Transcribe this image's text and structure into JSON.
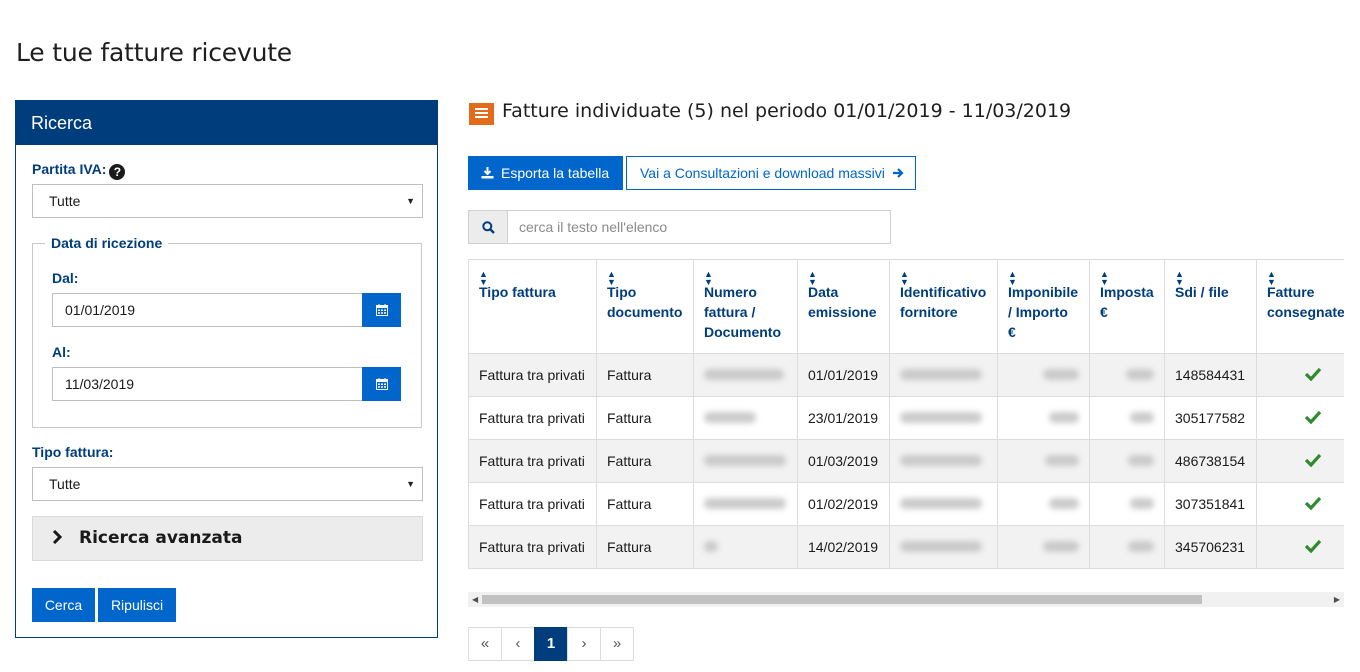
{
  "page_title": "Le tue fatture ricevute",
  "search_panel": {
    "title": "Ricerca",
    "partita_iva_label": "Partita IVA:",
    "partita_iva_value": "Tutte",
    "data_ricezione_legend": "Data di ricezione",
    "dal_label": "Dal:",
    "dal_value": "01/01/2019",
    "al_label": "Al:",
    "al_value": "11/03/2019",
    "tipo_fattura_label": "Tipo fattura:",
    "tipo_fattura_value": "Tutte",
    "advanced_label": "Ricerca avanzata",
    "search_button": "Cerca",
    "clear_button": "Ripulisci"
  },
  "results": {
    "title": "Fatture individuate (5) nel periodo 01/01/2019 - 11/03/2019",
    "export_button": "Esporta la tabella",
    "bulk_link": "Vai a Consultazioni e download massivi",
    "search_placeholder": "cerca il testo nell'elenco",
    "columns": [
      [
        "Tipo fattura"
      ],
      [
        "Tipo",
        "documento"
      ],
      [
        "Numero",
        "fattura /",
        "Documento"
      ],
      [
        "Data",
        "emissione"
      ],
      [
        "Identificativo",
        "fornitore"
      ],
      [
        "Imponibile",
        "/ Importo",
        "€"
      ],
      [
        "Imposta",
        "€"
      ],
      [
        "Sdi / file"
      ],
      [
        "Fatture",
        "consegnate"
      ]
    ],
    "rows": [
      {
        "tipo_fattura": "Fattura tra privati",
        "tipo_documento": "Fattura",
        "data_emissione": "01/01/2019",
        "sdi_file": "148584431",
        "consegnata": true
      },
      {
        "tipo_fattura": "Fattura tra privati",
        "tipo_documento": "Fattura",
        "data_emissione": "23/01/2019",
        "sdi_file": "305177582",
        "consegnata": true
      },
      {
        "tipo_fattura": "Fattura tra privati",
        "tipo_documento": "Fattura",
        "data_emissione": "01/03/2019",
        "sdi_file": "486738154",
        "consegnata": true
      },
      {
        "tipo_fattura": "Fattura tra privati",
        "tipo_documento": "Fattura",
        "data_emissione": "01/02/2019",
        "sdi_file": "307351841",
        "consegnata": true
      },
      {
        "tipo_fattura": "Fattura tra privati",
        "tipo_documento": "Fattura",
        "data_emissione": "14/02/2019",
        "sdi_file": "345706231",
        "consegnata": true
      }
    ]
  },
  "pagination": {
    "first": "«",
    "prev": "‹",
    "current": "1",
    "next": "›",
    "last": "»"
  },
  "colors": {
    "primary_dark": "#003d7c",
    "primary": "#0066cc",
    "accent_orange": "#e36b1c",
    "check_green": "#2e8b2e"
  },
  "icons": [
    "help-icon",
    "calendar-icon",
    "chevron-right-icon",
    "list-icon",
    "download-icon",
    "arrow-right-icon",
    "search-icon",
    "sort-icon",
    "check-icon"
  ]
}
